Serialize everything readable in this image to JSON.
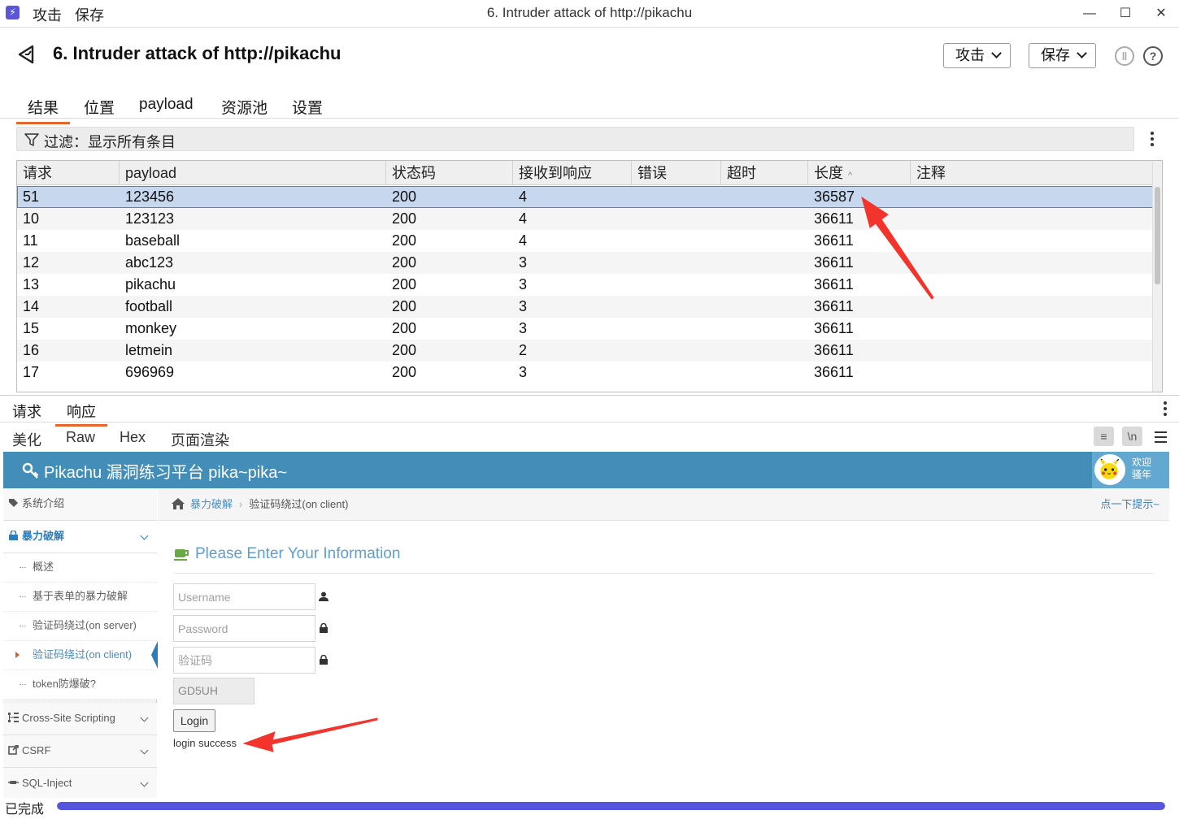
{
  "window": {
    "menu_attack": "攻击",
    "menu_save": "保存",
    "title": "6. Intruder attack of http://pikachu",
    "minimize": "—",
    "maximize": "☐",
    "close": "✕"
  },
  "header": {
    "title": "6. Intruder attack of http://pikachu",
    "attack_button": "攻击",
    "save_button": "保存",
    "pause_glyph": "‖",
    "help_glyph": "?"
  },
  "tabs": [
    "结果",
    "位置",
    "payload",
    "资源池",
    "设置"
  ],
  "filter": {
    "label": "过滤：显示所有条目"
  },
  "table": {
    "columns": [
      "请求",
      "payload",
      "状态码",
      "接收到响应",
      "错误",
      "超时",
      "长度",
      "注释"
    ],
    "sort_indicator": "^",
    "rows": [
      {
        "req": "51",
        "payload": "123456",
        "status": "200",
        "recv": "4",
        "length": "36587",
        "selected": true
      },
      {
        "req": "10",
        "payload": "123123",
        "status": "200",
        "recv": "4",
        "length": "36611"
      },
      {
        "req": "11",
        "payload": "baseball",
        "status": "200",
        "recv": "4",
        "length": "36611"
      },
      {
        "req": "12",
        "payload": "abc123",
        "status": "200",
        "recv": "3",
        "length": "36611"
      },
      {
        "req": "13",
        "payload": "pikachu",
        "status": "200",
        "recv": "3",
        "length": "36611"
      },
      {
        "req": "14",
        "payload": "football",
        "status": "200",
        "recv": "3",
        "length": "36611"
      },
      {
        "req": "15",
        "payload": "monkey",
        "status": "200",
        "recv": "3",
        "length": "36611"
      },
      {
        "req": "16",
        "payload": "letmein",
        "status": "200",
        "recv": "2",
        "length": "36611"
      },
      {
        "req": "17",
        "payload": "696969",
        "status": "200",
        "recv": "3",
        "length": "36611"
      }
    ]
  },
  "lower_tabs": [
    "请求",
    "响应"
  ],
  "sub_tabs": [
    "美化",
    "Raw",
    "Hex",
    "页面渲染"
  ],
  "tools": {
    "wrap": "≡",
    "newline": "\\n"
  },
  "page": {
    "brand": "Pikachu 漏洞练习平台 pika~pika~",
    "welcome_line1": "欢迎",
    "welcome_line2": "骚年",
    "sidebar": {
      "intro": "系统介绍",
      "brute": "暴力破解",
      "subs": [
        "概述",
        "基于表单的暴力破解",
        "验证码绕过(on server)",
        "验证码绕过(on client)",
        "token防爆破?"
      ],
      "xss": "Cross-Site Scripting",
      "csrf": "CSRF",
      "sqli": "SQL-Inject"
    },
    "breadcrumb": {
      "parent": "暴力破解",
      "current": "验证码绕过(on client)"
    },
    "hint": "点一下提示~",
    "form": {
      "title": "Please Enter Your Information",
      "username_placeholder": "Username",
      "password_placeholder": "Password",
      "captcha_placeholder": "验证码",
      "captcha_code": "GD5UH",
      "login": "Login",
      "message": "login success"
    }
  },
  "status": {
    "text": "已完成",
    "progress": 1.0
  },
  "colors": {
    "accent": "#e8652b",
    "nav": "#438eb9",
    "progress": "#5555dd",
    "arrow": "#f2342c"
  }
}
